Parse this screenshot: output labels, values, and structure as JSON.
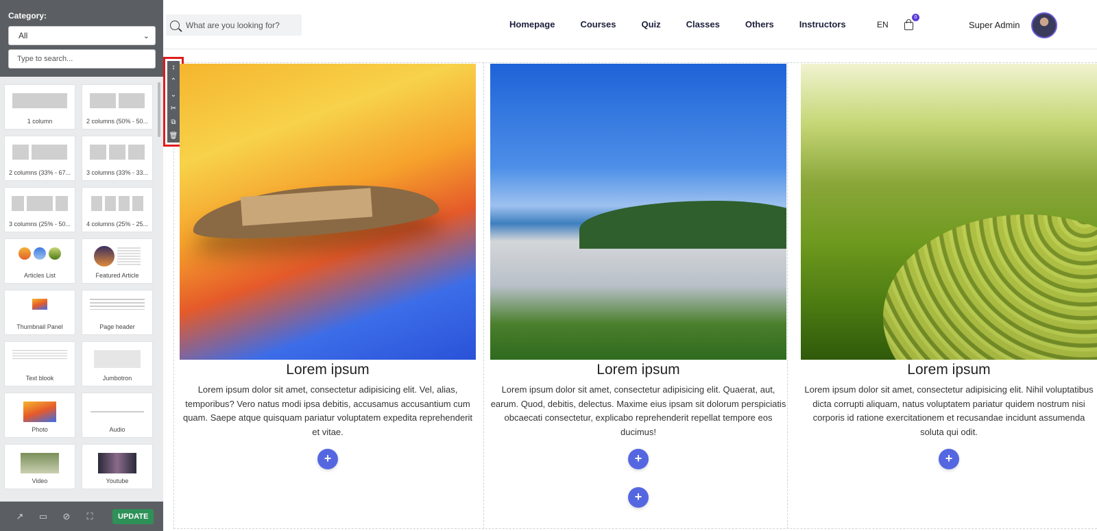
{
  "panel": {
    "category_label": "Category:",
    "category_value": "All",
    "search_placeholder": "Type to search...",
    "blocks": [
      {
        "label": "1 column"
      },
      {
        "label": "2 columns (50% - 50..."
      },
      {
        "label": "2 columns (33% - 67..."
      },
      {
        "label": "3 columns (33% - 33..."
      },
      {
        "label": "3 columns (25% - 50..."
      },
      {
        "label": "4 columns (25% - 25..."
      },
      {
        "label": "Articles List"
      },
      {
        "label": "Featured Article"
      },
      {
        "label": "Thumbnail Panel"
      },
      {
        "label": "Page header"
      },
      {
        "label": "Text blook"
      },
      {
        "label": "Jumbotron"
      },
      {
        "label": "Photo"
      },
      {
        "label": "Audio"
      },
      {
        "label": "Video"
      },
      {
        "label": "Youtube"
      }
    ],
    "footer": {
      "update_label": "UPDATE",
      "icons": [
        "external-link-icon",
        "laptop-icon",
        "eye-slash-icon",
        "fullscreen-icon"
      ]
    }
  },
  "header": {
    "search_placeholder": "What are you looking for?",
    "nav": [
      "Homepage",
      "Courses",
      "Quiz",
      "Classes",
      "Others",
      "Instructors"
    ],
    "language": "EN",
    "cart_count": "0",
    "user_name": "Super Admin"
  },
  "toolbar": {
    "icons": [
      "move-icon",
      "arrow-up-icon",
      "arrow-down-icon",
      "cut-icon",
      "copy-icon",
      "trash-icon"
    ]
  },
  "cards": [
    {
      "title": "Lorem ipsum",
      "text": "Lorem ipsum dolor sit amet, consectetur adipisicing elit. Vel, alias, temporibus? Vero natus modi ipsa debitis, accusamus accusantium cum quam. Saepe atque quisquam pariatur voluptatem expedita reprehenderit et vitae."
    },
    {
      "title": "Lorem ipsum",
      "text": "Lorem ipsum dolor sit amet, consectetur adipisicing elit. Quaerat, aut, earum. Quod, debitis, delectus. Maxime eius ipsam sit dolorum perspiciatis obcaecati consectetur, explicabo reprehenderit repellat tempore eos ducimus!"
    },
    {
      "title": "Lorem ipsum",
      "text": "Lorem ipsum dolor sit amet, consectetur adipisicing elit. Nihil voluptatibus dicta corrupti aliquam, natus voluptatem pariatur quidem nostrum nisi corporis id ratione exercitationem et recusandae incidunt assumenda soluta qui odit."
    }
  ],
  "add_symbol": "+",
  "colors": {
    "panel_bg": "#5b5f63",
    "update_green": "#2e9158",
    "add_button_blue": "#5567e0",
    "highlight_red": "#e01b1b",
    "nav_text": "#1b1e3a"
  }
}
